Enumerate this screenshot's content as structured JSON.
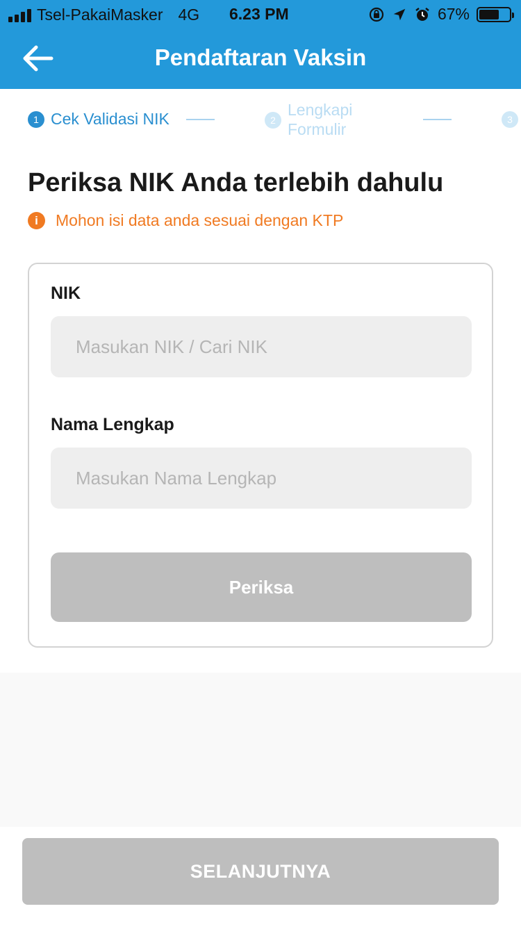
{
  "status_bar": {
    "carrier": "Tsel-PakaiMasker",
    "network": "4G",
    "time": "6.23 PM",
    "battery": "67%",
    "battery_level": 0.67
  },
  "header": {
    "title": "Pendaftaran Vaksin",
    "back_icon": "arrow-left-icon",
    "color": "#2399da"
  },
  "stepper": {
    "steps": [
      {
        "number": "1",
        "label": "Cek Validasi NIK",
        "active": true
      },
      {
        "number": "2",
        "label_line1": "Lengkapi",
        "label_line2": "Formulir",
        "active": false
      },
      {
        "number": "3",
        "label": "",
        "active": false
      }
    ]
  },
  "main": {
    "title": "Periksa NIK Anda terlebih dahulu",
    "notice": "Mohon isi data anda sesuai dengan KTP",
    "notice_color": "#f07a22"
  },
  "form": {
    "nik_label": "NIK",
    "nik_placeholder": "Masukan NIK / Cari NIK",
    "nik_value": "",
    "name_label": "Nama Lengkap",
    "name_placeholder": "Masukan Nama Lengkap",
    "name_value": "",
    "check_button": "Periksa"
  },
  "footer": {
    "next_button": "SELANJUTNYA"
  }
}
